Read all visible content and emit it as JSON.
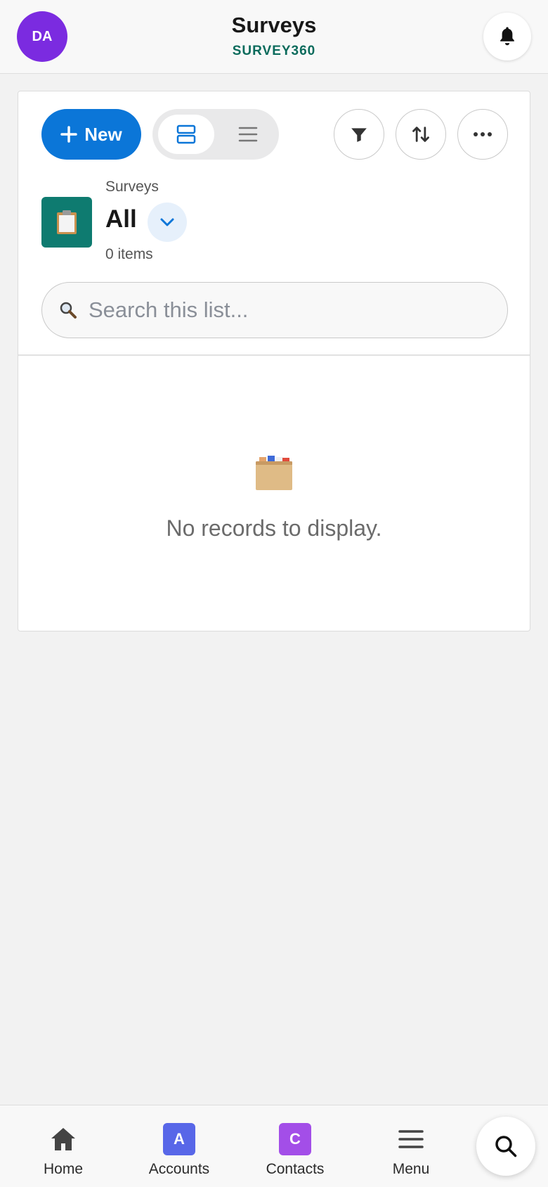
{
  "header": {
    "avatar_initials": "DA",
    "title": "Surveys",
    "subtitle": "SURVEY360",
    "avatar_color": "#7b2be0",
    "subtitle_color": "#0b6b5c"
  },
  "toolbar": {
    "new_label": "New",
    "new_icon": "plus-icon",
    "view_options": [
      "split-view-icon",
      "list-view-icon"
    ],
    "active_view": "split-view-icon",
    "actions": [
      "filter-icon",
      "sort-icon",
      "more-icon"
    ],
    "accent": "#0b76d8"
  },
  "list": {
    "object_label": "Surveys",
    "view_name": "All",
    "item_count": "0 items",
    "object_icon": "clipboard-icon",
    "object_icon_color": "#0e7b70"
  },
  "search": {
    "placeholder": "Search this list...",
    "value": ""
  },
  "empty_state": {
    "icon": "file-box-icon",
    "message": "No records to display."
  },
  "bottom_nav": {
    "items": [
      {
        "label": "Home",
        "icon": "home-icon"
      },
      {
        "label": "Accounts",
        "icon": "accounts-tile",
        "letter": "A",
        "color": "#5867e8"
      },
      {
        "label": "Contacts",
        "icon": "contacts-tile",
        "letter": "C",
        "color": "#a34ee8"
      },
      {
        "label": "Menu",
        "icon": "menu-icon"
      }
    ],
    "fab_icon": "search-icon"
  }
}
